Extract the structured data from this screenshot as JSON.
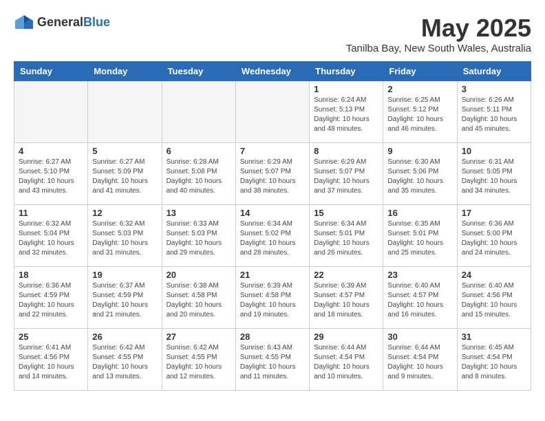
{
  "header": {
    "logo_general": "General",
    "logo_blue": "Blue",
    "month_title": "May 2025",
    "location": "Tanilba Bay, New South Wales, Australia"
  },
  "days_of_week": [
    "Sunday",
    "Monday",
    "Tuesday",
    "Wednesday",
    "Thursday",
    "Friday",
    "Saturday"
  ],
  "weeks": [
    [
      {
        "day": "",
        "info": ""
      },
      {
        "day": "",
        "info": ""
      },
      {
        "day": "",
        "info": ""
      },
      {
        "day": "",
        "info": ""
      },
      {
        "day": "1",
        "info": "Sunrise: 6:24 AM\nSunset: 5:13 PM\nDaylight: 10 hours\nand 48 minutes."
      },
      {
        "day": "2",
        "info": "Sunrise: 6:25 AM\nSunset: 5:12 PM\nDaylight: 10 hours\nand 46 minutes."
      },
      {
        "day": "3",
        "info": "Sunrise: 6:26 AM\nSunset: 5:11 PM\nDaylight: 10 hours\nand 45 minutes."
      }
    ],
    [
      {
        "day": "4",
        "info": "Sunrise: 6:27 AM\nSunset: 5:10 PM\nDaylight: 10 hours\nand 43 minutes."
      },
      {
        "day": "5",
        "info": "Sunrise: 6:27 AM\nSunset: 5:09 PM\nDaylight: 10 hours\nand 41 minutes."
      },
      {
        "day": "6",
        "info": "Sunrise: 6:28 AM\nSunset: 5:08 PM\nDaylight: 10 hours\nand 40 minutes."
      },
      {
        "day": "7",
        "info": "Sunrise: 6:29 AM\nSunset: 5:07 PM\nDaylight: 10 hours\nand 38 minutes."
      },
      {
        "day": "8",
        "info": "Sunrise: 6:29 AM\nSunset: 5:07 PM\nDaylight: 10 hours\nand 37 minutes."
      },
      {
        "day": "9",
        "info": "Sunrise: 6:30 AM\nSunset: 5:06 PM\nDaylight: 10 hours\nand 35 minutes."
      },
      {
        "day": "10",
        "info": "Sunrise: 6:31 AM\nSunset: 5:05 PM\nDaylight: 10 hours\nand 34 minutes."
      }
    ],
    [
      {
        "day": "11",
        "info": "Sunrise: 6:32 AM\nSunset: 5:04 PM\nDaylight: 10 hours\nand 32 minutes."
      },
      {
        "day": "12",
        "info": "Sunrise: 6:32 AM\nSunset: 5:03 PM\nDaylight: 10 hours\nand 31 minutes."
      },
      {
        "day": "13",
        "info": "Sunrise: 6:33 AM\nSunset: 5:03 PM\nDaylight: 10 hours\nand 29 minutes."
      },
      {
        "day": "14",
        "info": "Sunrise: 6:34 AM\nSunset: 5:02 PM\nDaylight: 10 hours\nand 28 minutes."
      },
      {
        "day": "15",
        "info": "Sunrise: 6:34 AM\nSunset: 5:01 PM\nDaylight: 10 hours\nand 26 minutes."
      },
      {
        "day": "16",
        "info": "Sunrise: 6:35 AM\nSunset: 5:01 PM\nDaylight: 10 hours\nand 25 minutes."
      },
      {
        "day": "17",
        "info": "Sunrise: 6:36 AM\nSunset: 5:00 PM\nDaylight: 10 hours\nand 24 minutes."
      }
    ],
    [
      {
        "day": "18",
        "info": "Sunrise: 6:36 AM\nSunset: 4:59 PM\nDaylight: 10 hours\nand 22 minutes."
      },
      {
        "day": "19",
        "info": "Sunrise: 6:37 AM\nSunset: 4:59 PM\nDaylight: 10 hours\nand 21 minutes."
      },
      {
        "day": "20",
        "info": "Sunrise: 6:38 AM\nSunset: 4:58 PM\nDaylight: 10 hours\nand 20 minutes."
      },
      {
        "day": "21",
        "info": "Sunrise: 6:39 AM\nSunset: 4:58 PM\nDaylight: 10 hours\nand 19 minutes."
      },
      {
        "day": "22",
        "info": "Sunrise: 6:39 AM\nSunset: 4:57 PM\nDaylight: 10 hours\nand 18 minutes."
      },
      {
        "day": "23",
        "info": "Sunrise: 6:40 AM\nSunset: 4:57 PM\nDaylight: 10 hours\nand 16 minutes."
      },
      {
        "day": "24",
        "info": "Sunrise: 6:40 AM\nSunset: 4:56 PM\nDaylight: 10 hours\nand 15 minutes."
      }
    ],
    [
      {
        "day": "25",
        "info": "Sunrise: 6:41 AM\nSunset: 4:56 PM\nDaylight: 10 hours\nand 14 minutes."
      },
      {
        "day": "26",
        "info": "Sunrise: 6:42 AM\nSunset: 4:55 PM\nDaylight: 10 hours\nand 13 minutes."
      },
      {
        "day": "27",
        "info": "Sunrise: 6:42 AM\nSunset: 4:55 PM\nDaylight: 10 hours\nand 12 minutes."
      },
      {
        "day": "28",
        "info": "Sunrise: 6:43 AM\nSunset: 4:55 PM\nDaylight: 10 hours\nand 11 minutes."
      },
      {
        "day": "29",
        "info": "Sunrise: 6:44 AM\nSunset: 4:54 PM\nDaylight: 10 hours\nand 10 minutes."
      },
      {
        "day": "30",
        "info": "Sunrise: 6:44 AM\nSunset: 4:54 PM\nDaylight: 10 hours\nand 9 minutes."
      },
      {
        "day": "31",
        "info": "Sunrise: 6:45 AM\nSunset: 4:54 PM\nDaylight: 10 hours\nand 8 minutes."
      }
    ]
  ]
}
